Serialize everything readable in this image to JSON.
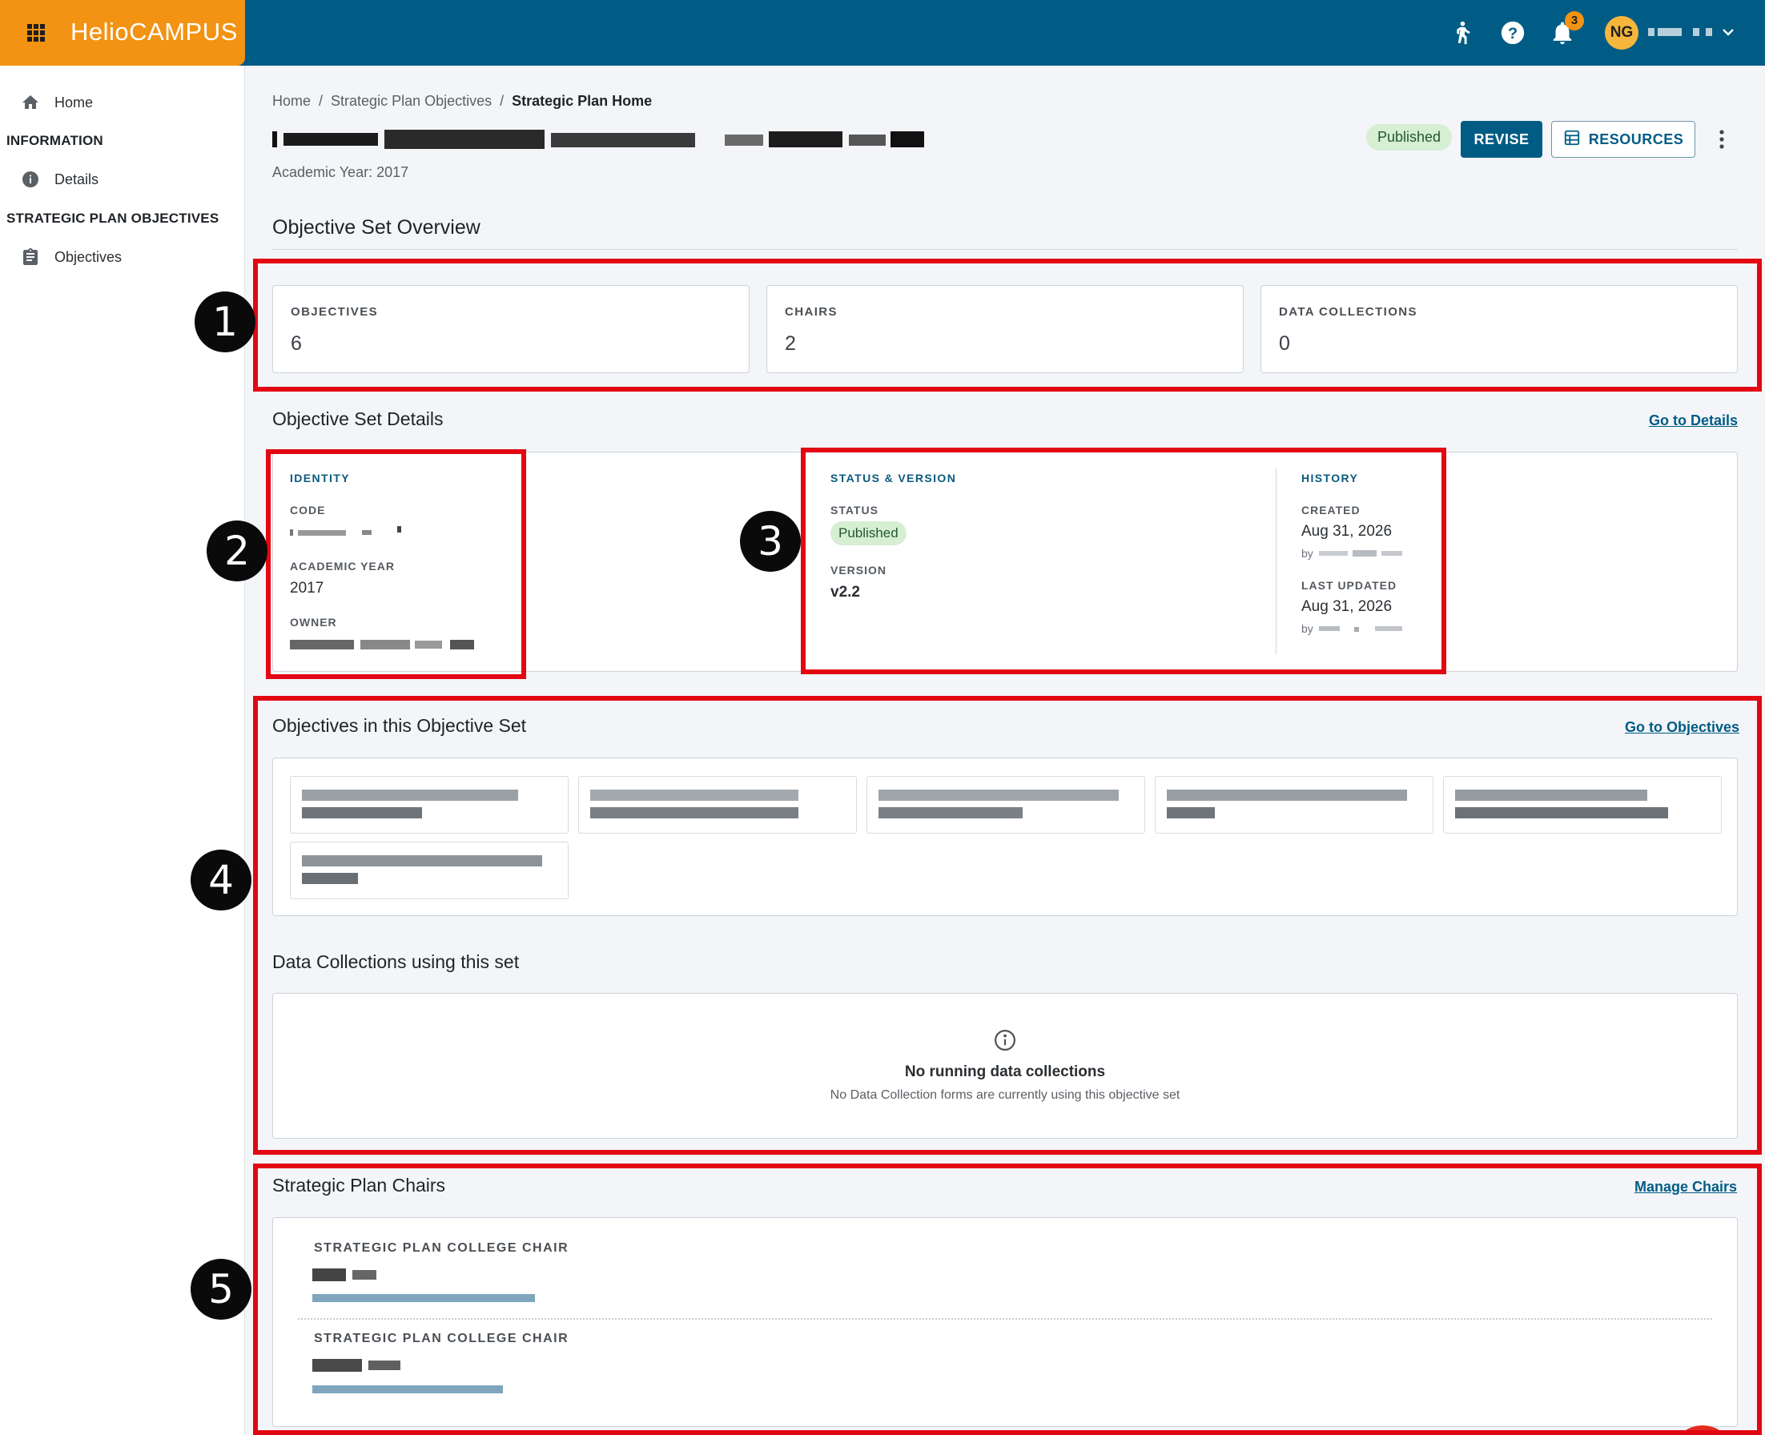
{
  "app": {
    "brand_part1": "Helio",
    "brand_part2": "CAMPUS",
    "notification_count": "3",
    "user_initials": "NG"
  },
  "sidebar": {
    "items": [
      {
        "label": "Home",
        "icon": "home-icon"
      },
      {
        "label": "Details",
        "icon": "info-icon"
      },
      {
        "label": "Objectives",
        "icon": "clipboard-icon"
      }
    ],
    "headers": [
      "INFORMATION",
      "STRATEGIC PLAN OBJECTIVES"
    ]
  },
  "breadcrumb": {
    "items": [
      "Home",
      "Strategic Plan Objectives"
    ],
    "current": "Strategic Plan Home",
    "separator": "/"
  },
  "header": {
    "academic_year_label": "Academic Year:",
    "academic_year": "2017",
    "status": "Published",
    "revise_label": "REVISE",
    "resources_label": "RESOURCES"
  },
  "overview": {
    "title": "Objective Set Overview",
    "kpis": [
      {
        "label": "OBJECTIVES",
        "value": "6"
      },
      {
        "label": "CHAIRS",
        "value": "2"
      },
      {
        "label": "DATA COLLECTIONS",
        "value": "0"
      }
    ]
  },
  "details": {
    "title": "Objective Set Details",
    "link": "Go to Details",
    "identity": {
      "heading": "IDENTITY",
      "code_label": "CODE",
      "year_label": "ACADEMIC YEAR",
      "year": "2017",
      "owner_label": "OWNER"
    },
    "status_version": {
      "heading": "STATUS & VERSION",
      "status_label": "STATUS",
      "status": "Published",
      "version_label": "VERSION",
      "version": "v2.2"
    },
    "history": {
      "heading": "HISTORY",
      "created_label": "CREATED",
      "created": "Aug 31, 2026",
      "updated_label": "LAST UPDATED",
      "updated": "Aug 31, 2026",
      "by_label": "by"
    }
  },
  "objectives_section": {
    "title": "Objectives in this Objective Set",
    "link": "Go to Objectives"
  },
  "data_collections": {
    "title": "Data Collections using this set",
    "empty_title": "No running data collections",
    "empty_desc": "No Data Collection forms are currently using this objective set"
  },
  "chairs": {
    "title": "Strategic Plan Chairs",
    "link": "Manage Chairs",
    "roles": [
      "STRATEGIC PLAN COLLEGE CHAIR",
      "STRATEGIC PLAN COLLEGE CHAIR"
    ]
  },
  "annotations": [
    "1",
    "2",
    "3",
    "4",
    "5"
  ],
  "colors": {
    "topbar": "#005c84",
    "brand": "#f39313",
    "annotation": "#e30613",
    "success_pill": "#d6efd3"
  }
}
